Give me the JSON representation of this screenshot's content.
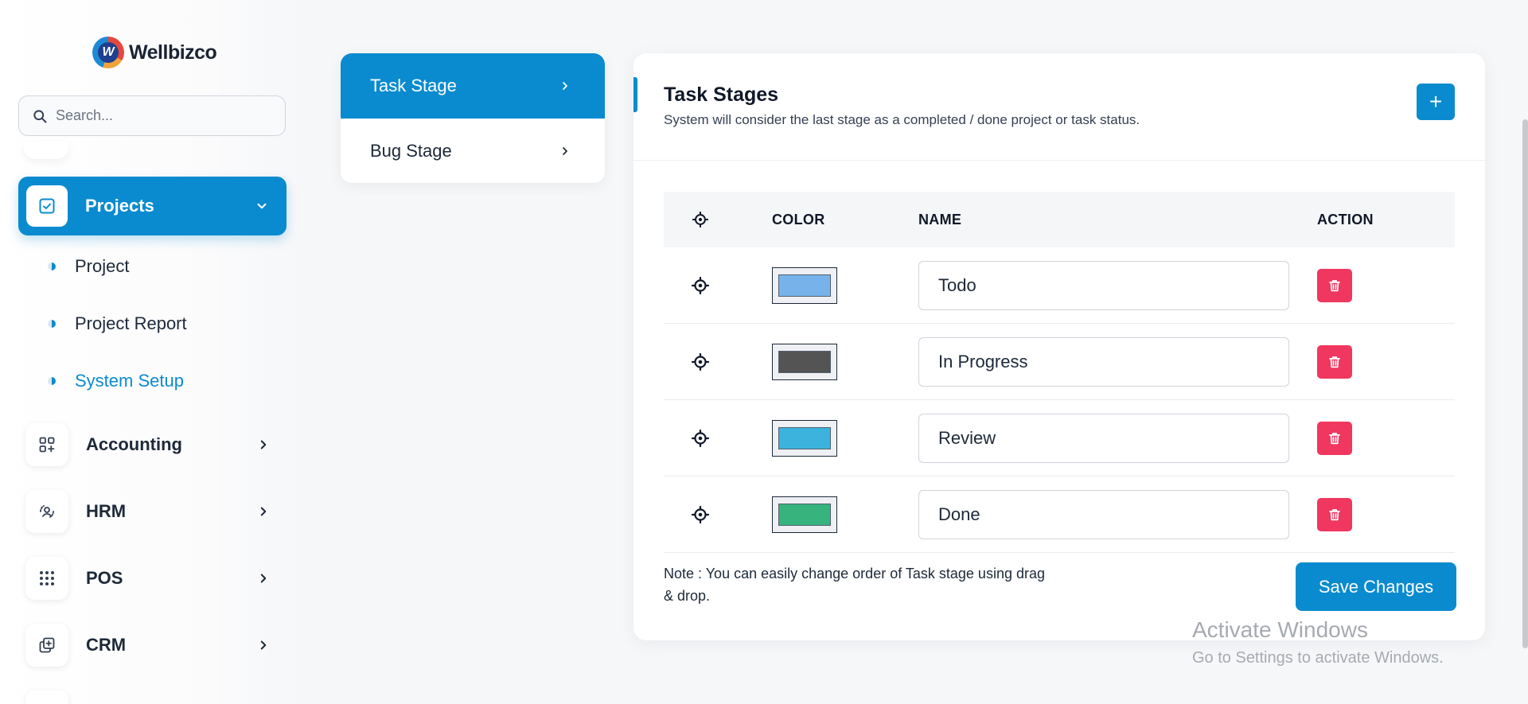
{
  "brand": {
    "name": "Wellbizco",
    "mark": "W"
  },
  "search": {
    "placeholder": "Search..."
  },
  "sidebar": {
    "active_group": "Projects",
    "sub_items": [
      "Project",
      "Project Report",
      "System Setup"
    ],
    "groups": [
      {
        "label": "Accounting",
        "icon": "grid-plus-icon"
      },
      {
        "label": "HRM",
        "icon": "users-cycle-icon"
      },
      {
        "label": "POS",
        "icon": "dots-grid-icon"
      },
      {
        "label": "CRM",
        "icon": "copy-plus-icon"
      }
    ]
  },
  "stage_menu": {
    "items": [
      "Task Stage",
      "Bug Stage"
    ],
    "active": "Task Stage"
  },
  "card": {
    "title": "Task Stages",
    "subtitle": "System will consider the last stage as a completed / done project or task status.",
    "add_label": "+"
  },
  "table": {
    "headers": {
      "color": "COLOR",
      "name": "NAME",
      "action": "ACTION"
    },
    "rows": [
      {
        "name": "Todo",
        "color": "#77b3ea"
      },
      {
        "name": "In Progress",
        "color": "#545454"
      },
      {
        "name": "Review",
        "color": "#3bb3dd"
      },
      {
        "name": "Done",
        "color": "#37b37e"
      }
    ]
  },
  "note": "Note : You can easily change order of Task stage using drag & drop.",
  "save_label": "Save Changes",
  "watermark": {
    "title": "Activate Windows",
    "subtitle": "Go to Settings to activate Windows."
  },
  "colors": {
    "accent": "#0a8bcf",
    "danger": "#f0375f"
  }
}
